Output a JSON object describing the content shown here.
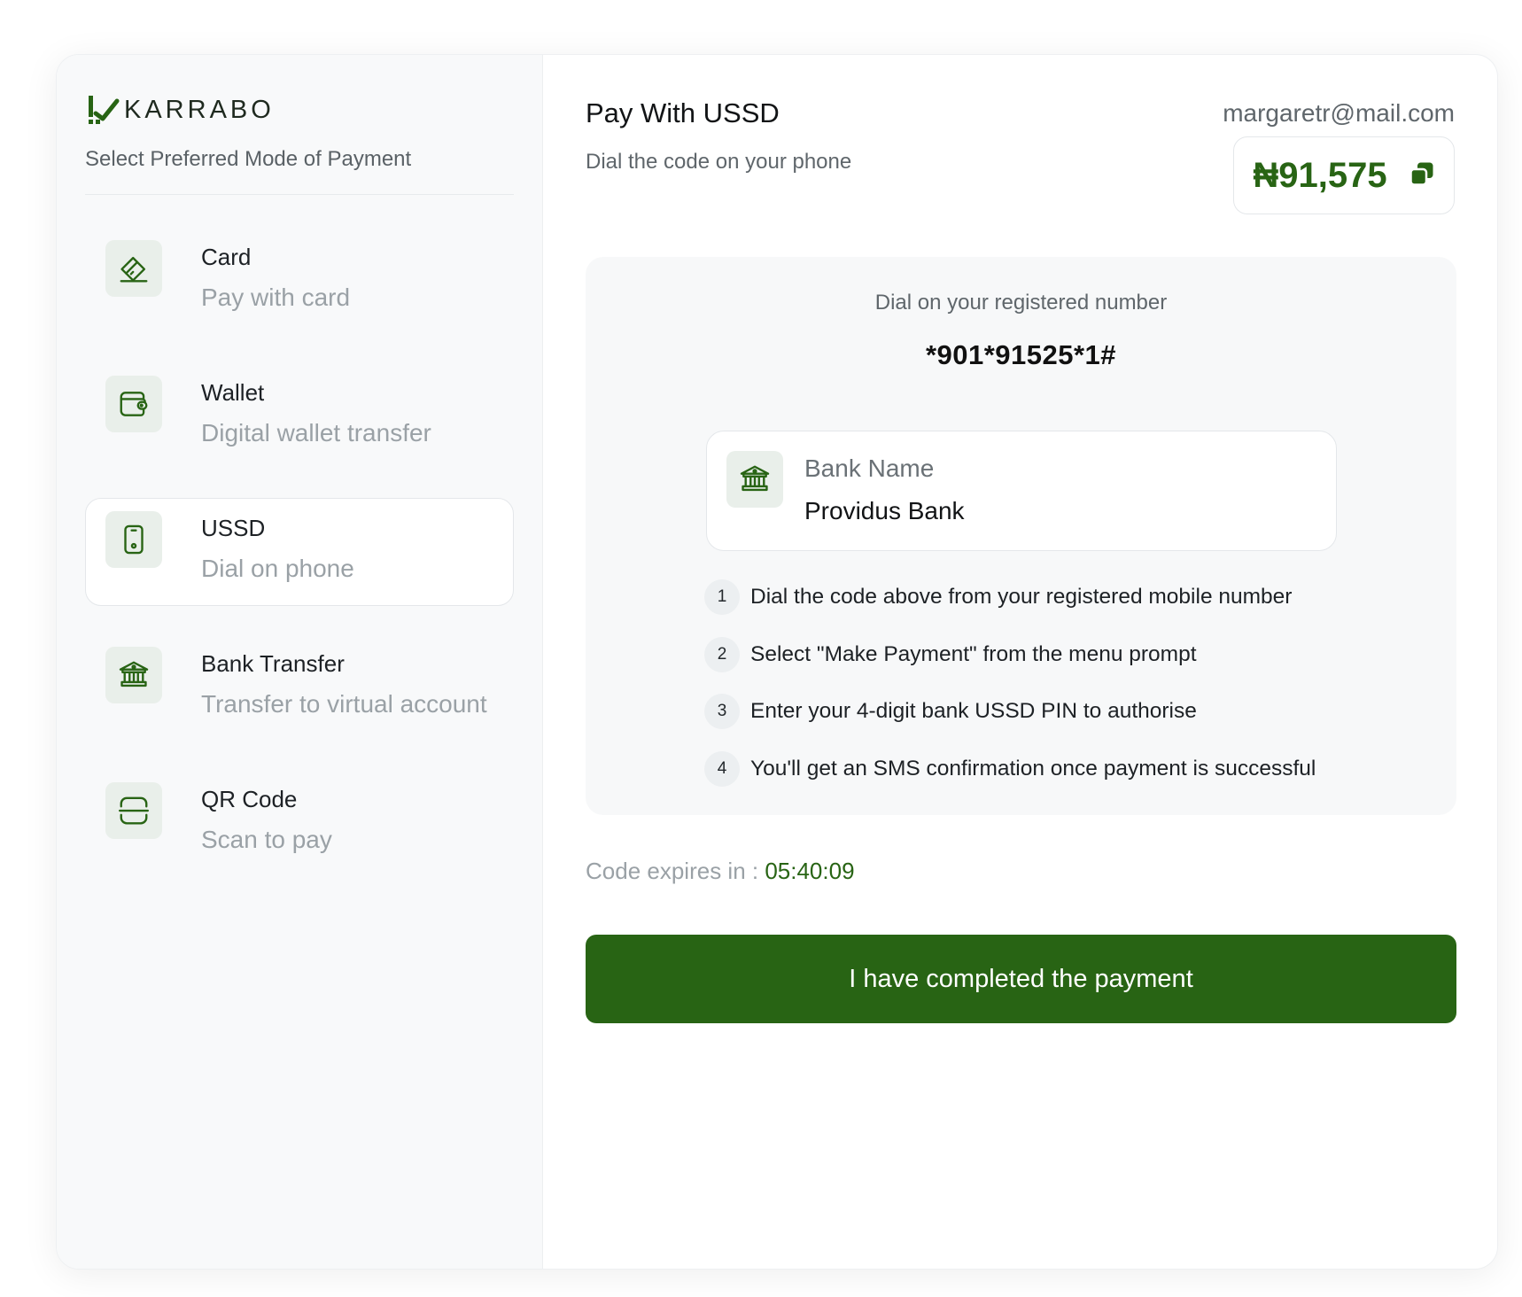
{
  "brand": {
    "name": "KARRABO",
    "accent": "#286414"
  },
  "sidebar": {
    "subtitle": "Select Preferred Mode of Payment",
    "methods": [
      {
        "title": "Card",
        "desc": "Pay with card",
        "icon": "card-icon"
      },
      {
        "title": "Wallet",
        "desc": "Digital wallet transfer",
        "icon": "wallet-icon"
      },
      {
        "title": "USSD",
        "desc": "Dial on phone",
        "icon": "phone-icon",
        "active": true
      },
      {
        "title": "Bank Transfer",
        "desc": "Transfer to virtual account",
        "icon": "bank-icon"
      },
      {
        "title": "QR Code",
        "desc": "Scan to pay",
        "icon": "qr-scan-icon"
      }
    ]
  },
  "main": {
    "title": "Pay With USSD",
    "subtitle": "Dial the code on your phone",
    "email": "margaretr@mail.com",
    "amount": "₦91,575",
    "dial_label": "Dial on your registered number",
    "dial_code": "*901*91525*1#",
    "bank": {
      "label": "Bank Name",
      "value": "Providus Bank"
    },
    "steps": [
      {
        "num": "1",
        "text": "Dial the code above from your registered mobile number"
      },
      {
        "num": "2",
        "text": "Select \"Make Payment\" from the menu prompt"
      },
      {
        "num": "3",
        "text": "Enter your 4-digit bank USSD PIN to authorise"
      },
      {
        "num": "4",
        "text": "You'll get an SMS confirmation once payment is successful"
      }
    ],
    "expires_label": "Code expires in : ",
    "expires_time": "05:40:09",
    "complete_label": "I have completed the payment"
  }
}
